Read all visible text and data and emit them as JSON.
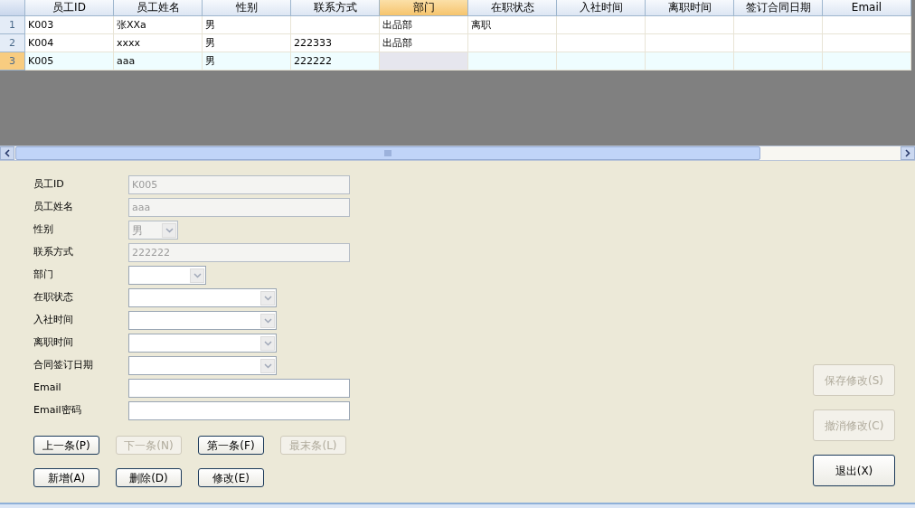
{
  "grid": {
    "columns": [
      {
        "label": "员工ID",
        "selected": false
      },
      {
        "label": "员工姓名",
        "selected": false
      },
      {
        "label": "性别",
        "selected": false
      },
      {
        "label": "联系方式",
        "selected": false
      },
      {
        "label": "部门",
        "selected": true
      },
      {
        "label": "在职状态",
        "selected": false
      },
      {
        "label": "入社时间",
        "selected": false
      },
      {
        "label": "离职时间",
        "selected": false
      },
      {
        "label": "签订合同日期",
        "selected": false
      },
      {
        "label": "Email",
        "selected": false
      }
    ],
    "rows": [
      {
        "number": "1",
        "selected": false,
        "cells": [
          "K003",
          "张XXa",
          "男",
          "",
          "出品部",
          "离职",
          "",
          "",
          "",
          ""
        ]
      },
      {
        "number": "2",
        "selected": false,
        "cells": [
          "K004",
          "xxxx",
          "男",
          "222333",
          "出品部",
          "",
          "",
          "",
          "",
          ""
        ]
      },
      {
        "number": "3",
        "selected": true,
        "cells": [
          "K005",
          "aaa",
          "男",
          "222222",
          "",
          "",
          "",
          "",
          "",
          ""
        ]
      }
    ]
  },
  "form": {
    "fields": [
      {
        "label": "员工ID",
        "kind": "text",
        "value": "K005",
        "disabled": true
      },
      {
        "label": "员工姓名",
        "kind": "text",
        "value": "aaa",
        "disabled": true
      },
      {
        "label": "性别",
        "kind": "narrow-select",
        "value": "男",
        "disabled": true
      },
      {
        "label": "联系方式",
        "kind": "text",
        "value": "222222",
        "disabled": true
      },
      {
        "label": "部门",
        "kind": "medium-select",
        "disabled": false
      },
      {
        "label": "在职状态",
        "kind": "select",
        "disabled": false
      },
      {
        "label": "入社时间",
        "kind": "select",
        "disabled": false
      },
      {
        "label": "离职时间",
        "kind": "select",
        "disabled": false
      },
      {
        "label": "合同签订日期",
        "kind": "select",
        "disabled": false
      },
      {
        "label": "Email",
        "kind": "text",
        "disabled": false
      },
      {
        "label": "Email密码",
        "kind": "text",
        "disabled": false
      }
    ],
    "nav_buttons": [
      {
        "label": "上一条(P)",
        "disabled": false
      },
      {
        "label": "下一条(N)",
        "disabled": true
      },
      {
        "label": "第一条(F)",
        "disabled": false
      },
      {
        "label": "最末条(L)",
        "disabled": true
      }
    ],
    "edit_buttons": [
      {
        "label": "新增(A)",
        "disabled": false
      },
      {
        "label": "删除(D)",
        "disabled": false
      },
      {
        "label": "修改(E)",
        "disabled": false
      }
    ],
    "side_buttons": [
      {
        "label": "保存修改(S)",
        "disabled": true
      },
      {
        "label": "撤消修改(C)",
        "disabled": true
      },
      {
        "label": "退出(X)",
        "disabled": false
      }
    ]
  }
}
